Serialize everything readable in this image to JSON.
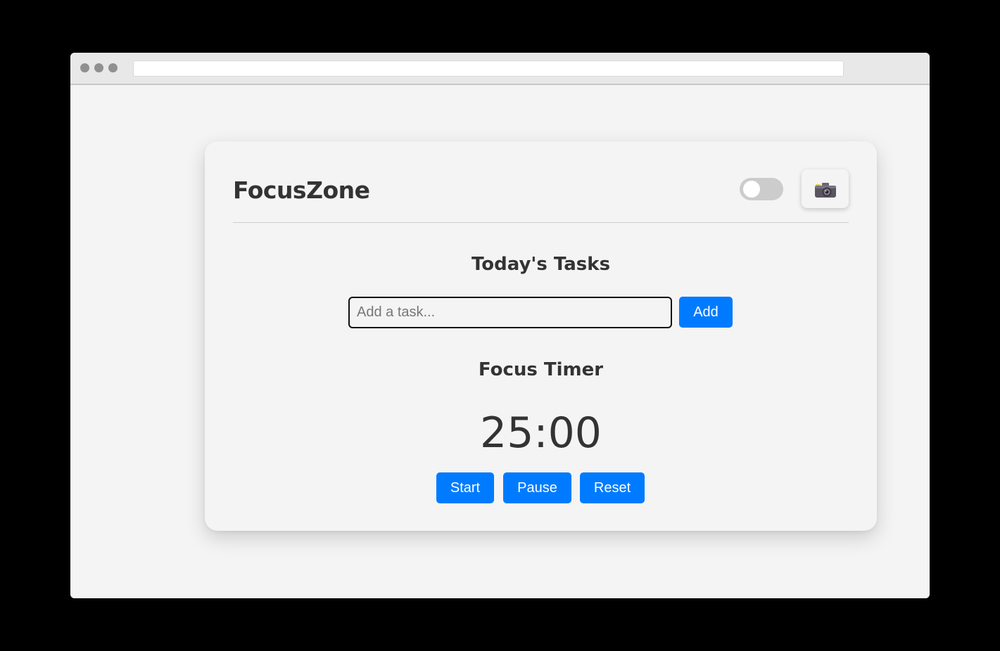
{
  "browser": {
    "address": ""
  },
  "app": {
    "title": "FocusZone",
    "theme_toggle_on": false,
    "camera_icon": "camera-icon"
  },
  "tasks": {
    "heading": "Today's Tasks",
    "input_placeholder": "Add a task...",
    "input_value": "",
    "add_label": "Add"
  },
  "timer": {
    "heading": "Focus Timer",
    "display": "25:00",
    "start_label": "Start",
    "pause_label": "Pause",
    "reset_label": "Reset"
  },
  "colors": {
    "accent": "#007bff",
    "background": "#f4f4f4",
    "text": "#333333"
  }
}
